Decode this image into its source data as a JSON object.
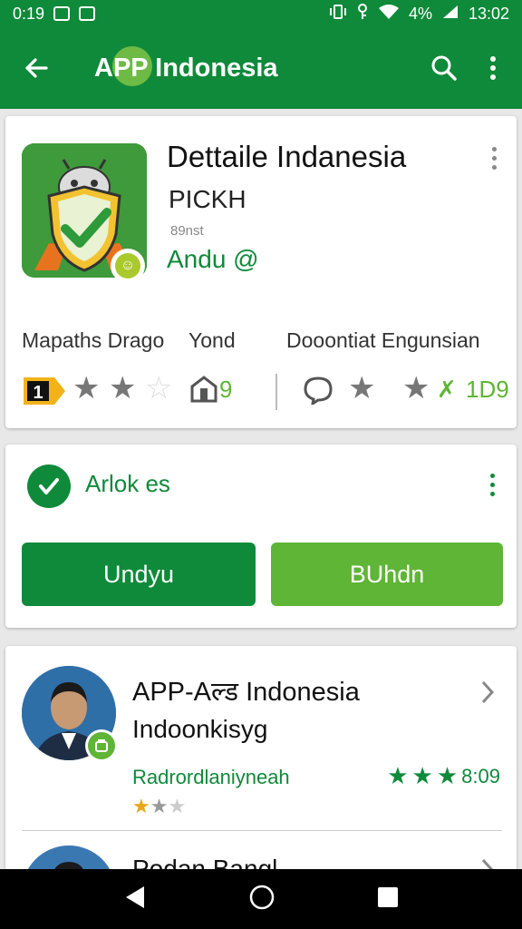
{
  "status_bar": {
    "time": "0:19",
    "battery": "4%",
    "clock": "13:02"
  },
  "app_bar": {
    "title": "APP Indonesia"
  },
  "app_card": {
    "title": "Dettaile Indanesia",
    "subtitle": "PICKH",
    "small_text": "89nst",
    "developer": "Andu @",
    "labels": [
      "Mapaths Drago",
      "Yond",
      "Dooontiat Engunsian"
    ],
    "stats_left_value": "9",
    "stats_right_value": "1D9",
    "star_colors": {
      "filled": "#777777",
      "empty": "#dddddd"
    }
  },
  "action_card": {
    "status_label": "Arlok es",
    "primary_button": "Undyu",
    "secondary_button": "BUhdn"
  },
  "list_card": {
    "item1": {
      "title": "APP-Aल्ड Indonesia",
      "subtitle": "Indoonkisyg",
      "developer": "Radrordlaniyneah",
      "rating_value": "8:09"
    },
    "item2": {
      "title": "Podan Bangl..."
    }
  },
  "nav_bar": {
    "back": "back-icon",
    "home": "home-icon",
    "recents": "recents-icon"
  },
  "colors": {
    "primary": "#0f8a3a",
    "accent": "#5fb536"
  }
}
